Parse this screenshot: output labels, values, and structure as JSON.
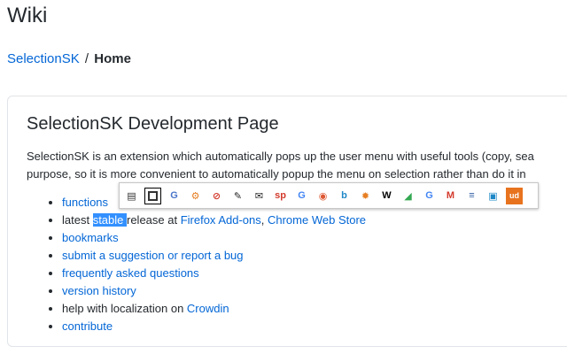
{
  "header": {
    "title": "Wiki"
  },
  "breadcrumb": {
    "project": "SelectionSK",
    "separator": "/",
    "current": "Home"
  },
  "card": {
    "title": "SelectionSK Development Page",
    "paragraph_line1": "SelectionSK is an extension which automatically pops up the user menu with useful tools (copy, sea",
    "paragraph_line2": "purpose, so it is more convenient to automatically popup the menu on selection rather than do it in",
    "list": {
      "functions": "functions",
      "latest_prefix": "latest ",
      "latest_selected": "stable ",
      "latest_middle": "release at ",
      "firefox": "Firefox Add-ons",
      "comma": ", ",
      "chrome": "Chrome Web Store",
      "bookmarks": "bookmarks",
      "suggestion": "submit a suggestion or report a bug",
      "faq": "frequently asked questions",
      "history": "version history",
      "localization_prefix": "help with localization on ",
      "crowdin": "Crowdin",
      "contribute": "contribute"
    }
  },
  "toolbar": {
    "buttons": [
      {
        "icon": "copy-icon",
        "glyph": "▤",
        "color": "#333333"
      },
      {
        "icon": "select-all-icon",
        "glyph": "",
        "color": "#333333"
      },
      {
        "icon": "translate-icon",
        "glyph": "G",
        "color": "#4a76c9"
      },
      {
        "icon": "gear-icon",
        "glyph": "⚙",
        "color": "#e67e22"
      },
      {
        "icon": "adblock-icon",
        "glyph": "⊘",
        "color": "#d33a2c"
      },
      {
        "icon": "pen-icon",
        "glyph": "✎",
        "color": "#222222"
      },
      {
        "icon": "mail-icon",
        "glyph": "✉",
        "color": "#222222"
      },
      {
        "icon": "startpage-icon",
        "glyph": "sp",
        "color": "#d33a2c"
      },
      {
        "icon": "google-icon",
        "glyph": "G",
        "color": "#4285f4"
      },
      {
        "icon": "duckduckgo-icon",
        "glyph": "◉",
        "color": "#de5833"
      },
      {
        "icon": "bing-icon",
        "glyph": "b",
        "color": "#1e88c7"
      },
      {
        "icon": "settings-icon",
        "glyph": "✹",
        "color": "#e67e22"
      },
      {
        "icon": "wikipedia-icon",
        "glyph": "W",
        "color": "#000000"
      },
      {
        "icon": "maps-icon",
        "glyph": "◢",
        "color": "#34a853"
      },
      {
        "icon": "google-search-icon",
        "glyph": "G",
        "color": "#4285f4"
      },
      {
        "icon": "merriam-webster-icon",
        "glyph": "M",
        "color": "#d33a2c"
      },
      {
        "icon": "dictionary-icon",
        "glyph": "≡",
        "color": "#2c5aa0"
      },
      {
        "icon": "thesaurus-icon",
        "glyph": "▣",
        "color": "#1e88c7"
      },
      {
        "icon": "urban-dictionary-icon",
        "glyph": "ud",
        "color": "#ffffff",
        "bg": "#e8731e"
      }
    ]
  },
  "colors": {
    "link": "#0366d6",
    "text": "#24292e",
    "selection": "#3390ff",
    "border": "#e1e4e8"
  }
}
